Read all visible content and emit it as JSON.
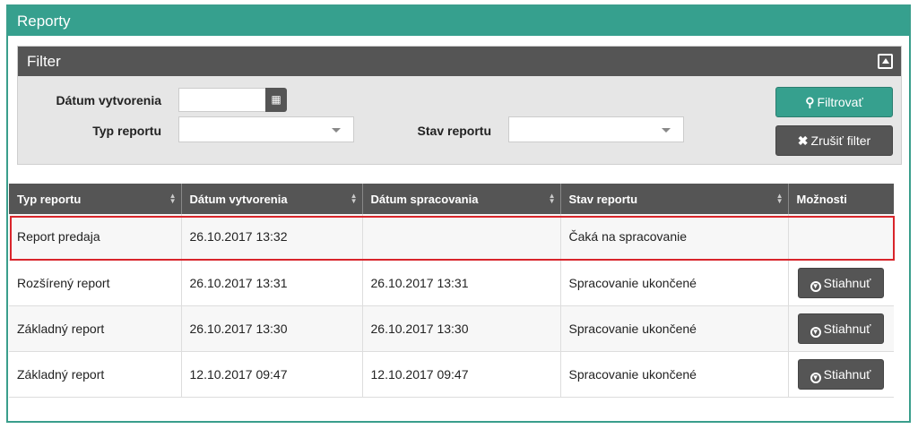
{
  "panel": {
    "title": "Reporty"
  },
  "filter": {
    "title": "Filter",
    "date_label": "Dátum vytvorenia",
    "date_value": "",
    "type_label": "Typ reportu",
    "type_value": "",
    "state_label": "Stav reportu",
    "state_value": "",
    "apply_label": "Filtrovať",
    "reset_label": "Zrušiť filter"
  },
  "table": {
    "columns": [
      "Typ reportu",
      "Dátum vytvorenia",
      "Dátum spracovania",
      "Stav reportu",
      "Možnosti"
    ],
    "rows": [
      {
        "type": "Report predaja",
        "created": "26.10.2017 13:32",
        "processed": "",
        "state": "Čaká na spracovanie",
        "action": ""
      },
      {
        "type": "Rozšírený report",
        "created": "26.10.2017 13:31",
        "processed": "26.10.2017 13:31",
        "state": "Spracovanie ukončené",
        "action": "Stiahnuť"
      },
      {
        "type": "Základný report",
        "created": "26.10.2017 13:30",
        "processed": "26.10.2017 13:30",
        "state": "Spracovanie ukončené",
        "action": "Stiahnuť"
      },
      {
        "type": "Základný report",
        "created": "12.10.2017 09:47",
        "processed": "12.10.2017 09:47",
        "state": "Spracovanie ukončené",
        "action": "Stiahnuť"
      }
    ]
  },
  "colors": {
    "accent": "#36a08e",
    "dark": "#555555",
    "highlight": "#d9252b"
  }
}
